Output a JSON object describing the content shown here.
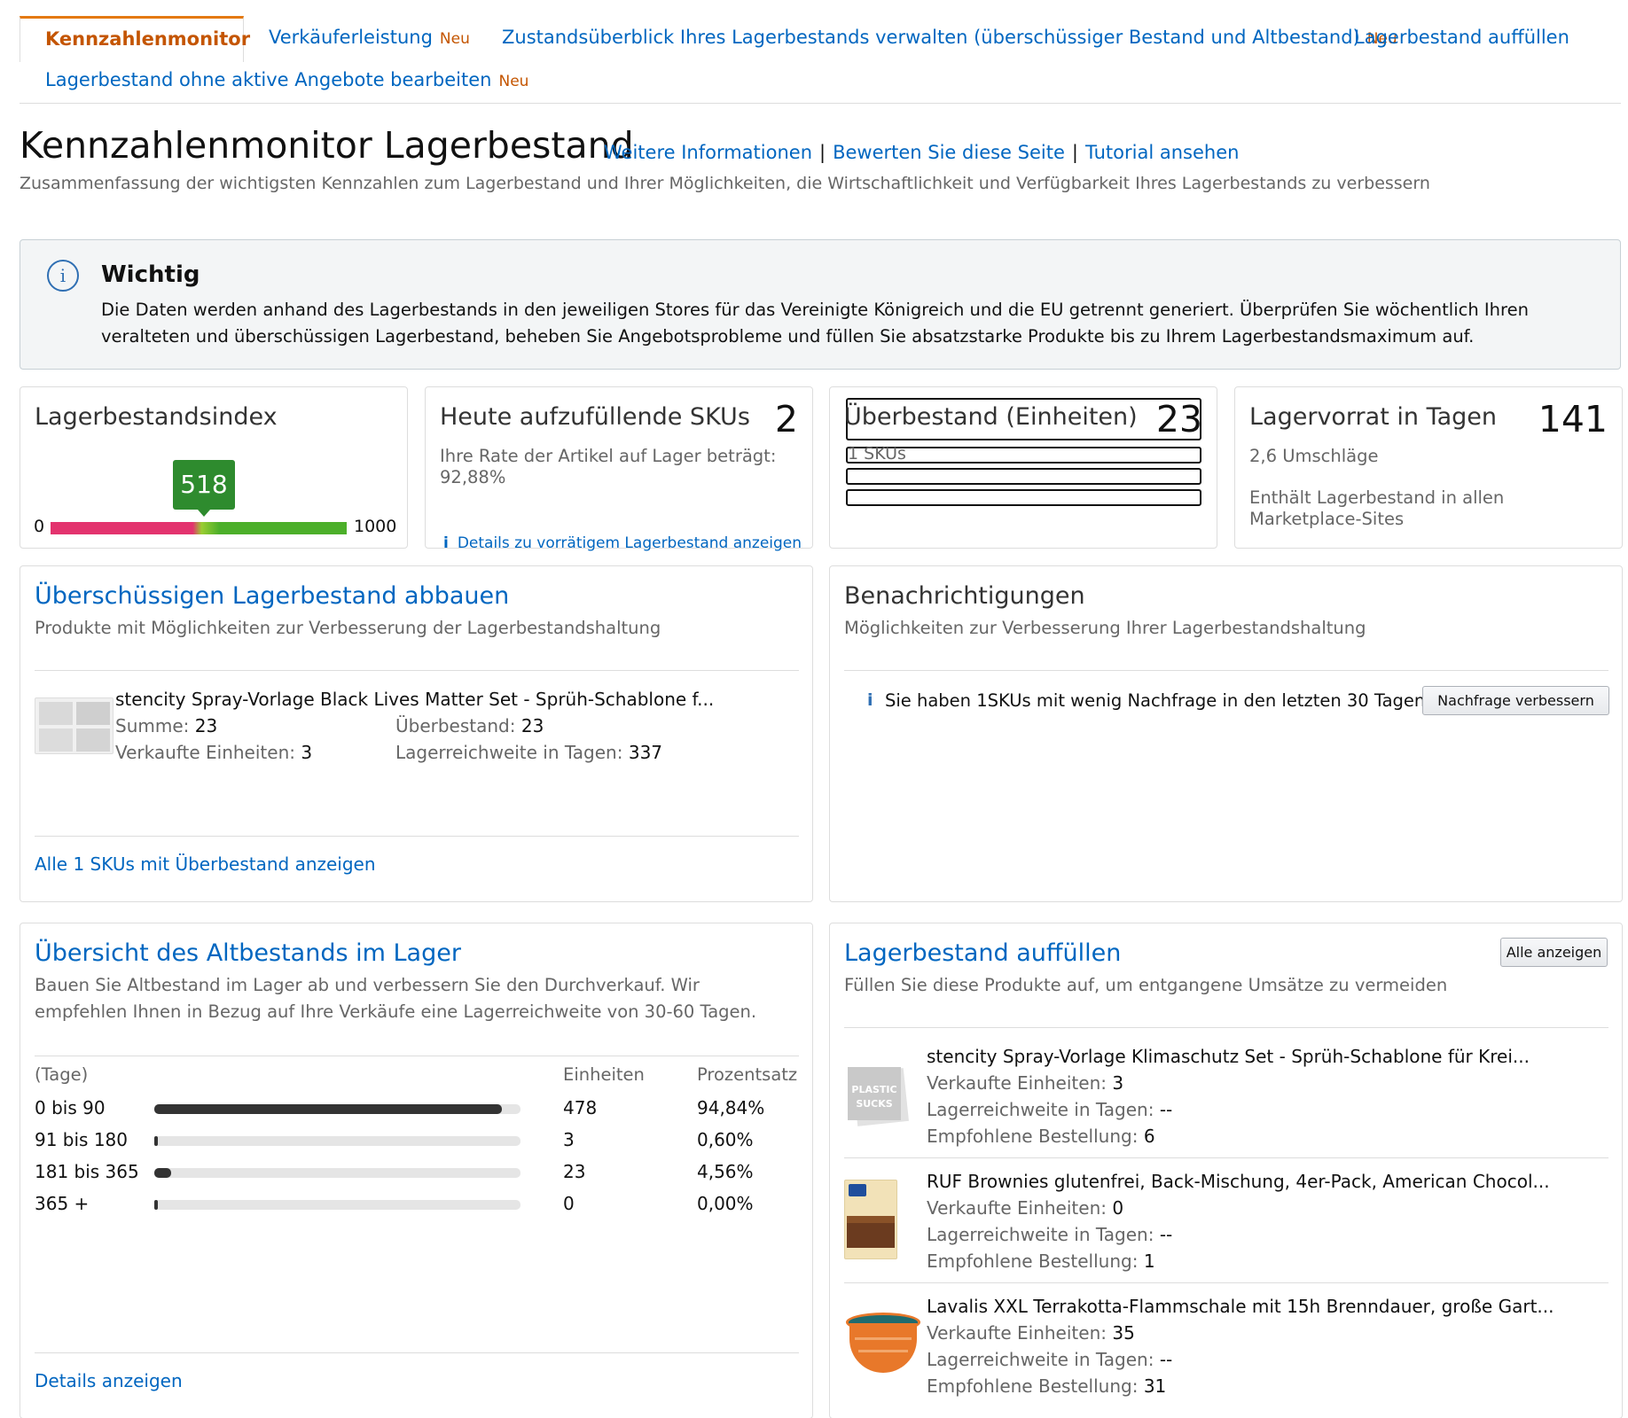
{
  "tabs": {
    "active": "Kennzahlenmonitor",
    "items": [
      {
        "label": "Verkäuferleistung",
        "badge": "Neu"
      },
      {
        "label": "Zustandsüberblick Ihres Lagerbestands verwalten (überschüssiger Bestand und Altbestand)",
        "badge": "Neu"
      },
      {
        "label": "Lagerbestand auffüllen",
        "badge": ""
      },
      {
        "label": "Lagerbestand ohne aktive Angebote bearbeiten",
        "badge": "Neu"
      }
    ]
  },
  "header": {
    "title": "Kennzahlenmonitor Lagerbestand",
    "link_info": "Weitere Informationen",
    "link_rate": "Bewerten Sie diese Seite",
    "link_tutorial": "Tutorial ansehen",
    "separator": "|",
    "subtitle": "Zusammenfassung der wichtigsten Kennzahlen zum Lagerbestand und Ihrer Möglichkeiten, die Wirtschaftlichkeit und Verfügbarkeit Ihres Lagerbestands zu verbessern"
  },
  "alert": {
    "icon": "info-icon",
    "title": "Wichtig",
    "body": "Die Daten werden anhand des Lagerbestands in den jeweiligen Stores für das Vereinigte Königreich und die EU getrennt generiert. Überprüfen Sie wöchentlich Ihren veralteten und überschüssigen Lagerbestand, beheben Sie Angebotsprobleme und füllen Sie absatzstarke Produkte bis zu Ihrem Lagerbestandsmaximum auf."
  },
  "metrics": {
    "index": {
      "title": "Lagerbestandsindex",
      "value": "518",
      "min": "0",
      "max": "1000",
      "fraction": 0.518
    },
    "skus": {
      "title": "Heute aufzufüllende SKUs",
      "value": "2",
      "text": "Ihre Rate der Artikel auf Lager beträgt: 92,88%",
      "link": "Details zu vorrätigem Lagerbestand anzeigen",
      "link_icon": "i"
    },
    "overstock": {
      "title": "Überbestand (Einheiten)",
      "value": "23",
      "sub": "1 SKUs"
    },
    "supply": {
      "title": "Lagervorrat in Tagen",
      "value": "141",
      "turns": "2,6 Umschläge",
      "note": "Enthält Lagerbestand in allen Marketplace-Sites"
    }
  },
  "excess": {
    "title": "Überschüssigen Lagerbestand abbauen",
    "subtitle": "Produkte mit Möglichkeiten zur Verbesserung der Lagerbestandshaltung",
    "product": {
      "name": "stencity Spray-Vorlage Black Lives Matter Set - Sprüh-Schablone f...",
      "sum_label": "Summe:",
      "sum": "23",
      "over_label": "Überbestand:",
      "over": "23",
      "sold_label": "Verkaufte Einheiten:",
      "sold": "3",
      "reach_label": "Lagerreichweite in Tagen:",
      "reach": "337"
    },
    "footer_link": "Alle 1 SKUs mit Überbestand anzeigen"
  },
  "notifications": {
    "title": "Benachrichtigungen",
    "subtitle": "Möglichkeiten zur Verbesserung Ihrer Lagerbestandshaltung",
    "icon": "i",
    "message": "Sie haben 1SKUs mit wenig Nachfrage in den letzten 30 Tagen.",
    "button": "Nachfrage verbessern"
  },
  "aging": {
    "title": "Übersicht des Altbestands im Lager",
    "subtitle": "Bauen Sie Altbestand im Lager ab und verbessern Sie den Durchverkauf. Wir empfehlen Ihnen in Bezug auf Ihre Verkäufe eine Lagerreichweite von 30-60 Tagen.",
    "col_days": "(Tage)",
    "col_units": "Einheiten",
    "col_pct": "Prozentsatz",
    "rows": [
      {
        "label": "0 bis 90",
        "units": "478",
        "pct": "94,84%",
        "fraction": 0.9484
      },
      {
        "label": "91 bis 180",
        "units": "3",
        "pct": "0,60%",
        "fraction": 0.006
      },
      {
        "label": "181 bis 365",
        "units": "23",
        "pct": "4,56%",
        "fraction": 0.0456
      },
      {
        "label": "365 +",
        "units": "0",
        "pct": "0,00%",
        "fraction": 0.0
      }
    ],
    "footer_link": "Details anzeigen"
  },
  "restock": {
    "title": "Lagerbestand auffüllen",
    "subtitle": "Füllen Sie diese Produkte auf, um entgangene Umsätze zu vermeiden",
    "button": "Alle anzeigen",
    "sold_label": "Verkaufte Einheiten:",
    "reach_label": "Lagerreichweite in Tagen:",
    "order_label": "Empfohlene Bestellung:",
    "items": [
      {
        "name": "stencity Spray-Vorlage Klimaschutz Set - Sprüh-Schablone für Krei...",
        "sold": "3",
        "reach": "--",
        "order": "6",
        "thumb_text": "PLASTIC SUCKS"
      },
      {
        "name": "RUF Brownies glutenfrei, Back-Mischung, 4er-Pack, American Chocol...",
        "sold": "0",
        "reach": "--",
        "order": "1"
      },
      {
        "name": "Lavalis XXL Terrakotta-Flammschale mit 15h Brenndauer, große Gart...",
        "sold": "35",
        "reach": "--",
        "order": "31"
      }
    ]
  }
}
